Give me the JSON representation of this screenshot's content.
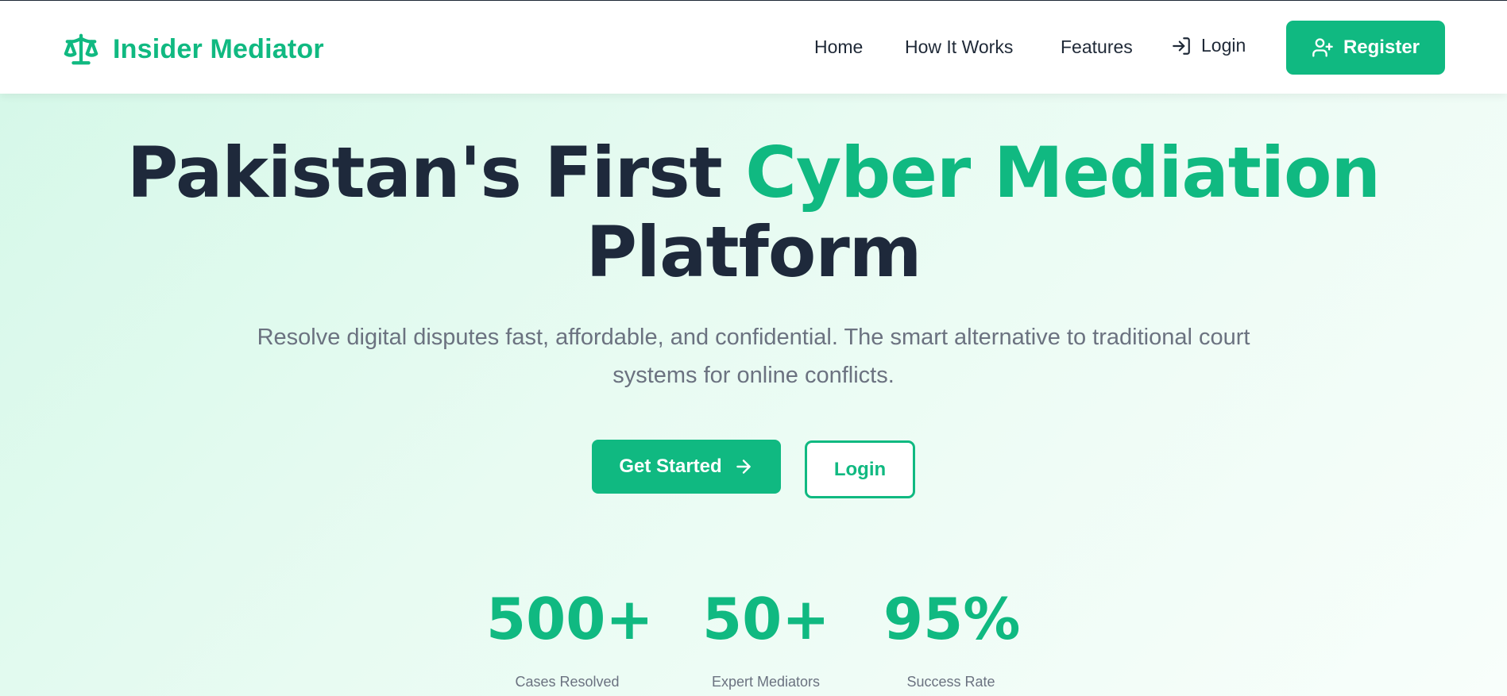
{
  "brand": {
    "name": "Insider Mediator",
    "icon": "scale-icon"
  },
  "nav": {
    "home": "Home",
    "how_it_works": "How It Works",
    "features": "Features",
    "login": "Login",
    "register": "Register"
  },
  "hero": {
    "title_part1": "Pakistan's First ",
    "title_accent": "Cyber Mediation",
    "title_part2": "Platform",
    "subtitle": "Resolve digital disputes fast, affordable, and confidential. The smart alternative to traditional court systems for online conflicts.",
    "primary_cta": "Get Started",
    "secondary_cta": "Login"
  },
  "stats": [
    {
      "value": "500+",
      "label": "Cases Resolved"
    },
    {
      "value": "50+",
      "label": "Expert Mediators"
    },
    {
      "value": "95%",
      "label": "Success Rate"
    }
  ],
  "colors": {
    "accent": "#10b981",
    "heading": "#1e293b",
    "muted": "#6b7280"
  }
}
